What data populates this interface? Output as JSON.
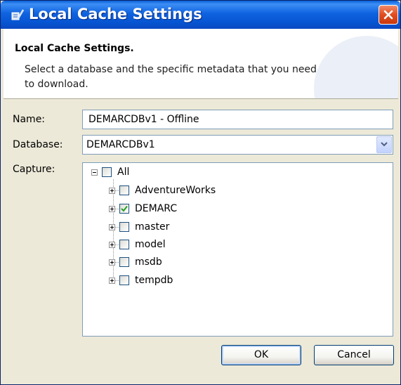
{
  "window": {
    "title": "Local Cache Settings"
  },
  "header": {
    "title": "Local Cache Settings.",
    "description": "Select a database and the specific metadata that you need to download."
  },
  "form": {
    "name_label": "Name:",
    "name_value": "DEMARCDBv1 - Offline",
    "database_label": "Database:",
    "database_value": "DEMARCDBv1",
    "capture_label": "Capture:"
  },
  "tree": {
    "root": {
      "label": "All",
      "checked": false,
      "expanded": true
    },
    "children": [
      {
        "label": "AdventureWorks",
        "checked": false
      },
      {
        "label": "DEMARC",
        "checked": true
      },
      {
        "label": "master",
        "checked": false
      },
      {
        "label": "model",
        "checked": false
      },
      {
        "label": "msdb",
        "checked": false
      },
      {
        "label": "tempdb",
        "checked": false
      }
    ]
  },
  "buttons": {
    "ok_label": "OK",
    "cancel_label": "Cancel"
  },
  "colors": {
    "titlebar": "#0753d0",
    "close": "#e24d1f",
    "check": "#21a121",
    "dialog_bg": "#ece9d8"
  }
}
